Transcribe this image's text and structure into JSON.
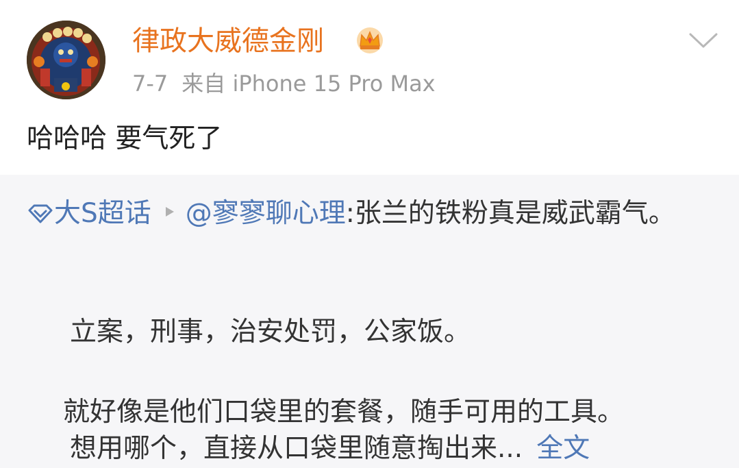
{
  "post": {
    "user_name": "律政大威德金刚",
    "badge_icon": "crown-badge-icon",
    "date": "7-7",
    "source": "来自 iPhone 15 Pro Max",
    "text": "哈哈哈 要气死了"
  },
  "repost": {
    "super_topic": "大S超话",
    "mention": "@寥寥聊心理",
    "lead_text": ":张兰的铁粉真是威武霸气。",
    "paragraph_1": "立案，刑事，治安处罚，公家饭。",
    "paragraph_2_line_1": "就好像是他们口袋里的套餐，随手可用的工具。",
    "paragraph_2_line_2": "想用哪个，直接从口袋里随意掏出来...",
    "full_text_link": "全文"
  },
  "colors": {
    "username": "#e8731f",
    "link_blue": "#4f78b6",
    "meta_gray": "#9a9a9a",
    "repost_bg": "#f6f6f8"
  }
}
